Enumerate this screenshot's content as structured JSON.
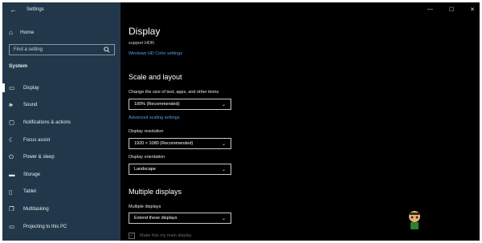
{
  "window": {
    "title": "Settings",
    "controls": [
      "—",
      "☐",
      "✕"
    ]
  },
  "sidebar": {
    "home_label": "Home",
    "search_placeholder": "Find a setting",
    "section_label": "System",
    "items": [
      {
        "label": "Display",
        "icon": "monitor-icon",
        "glyph": "▭",
        "active": true
      },
      {
        "label": "Sound",
        "icon": "sound-icon",
        "glyph": "🕪",
        "active": false
      },
      {
        "label": "Notifications & actions",
        "icon": "notifications-icon",
        "glyph": "▢",
        "active": false
      },
      {
        "label": "Focus assist",
        "icon": "focus-assist-icon",
        "glyph": "☾",
        "active": false
      },
      {
        "label": "Power & sleep",
        "icon": "power-icon",
        "glyph": "⏻",
        "active": false
      },
      {
        "label": "Storage",
        "icon": "storage-icon",
        "glyph": "▬",
        "active": false
      },
      {
        "label": "Tablet",
        "icon": "tablet-icon",
        "glyph": "▯",
        "active": false
      },
      {
        "label": "Multitasking",
        "icon": "multitasking-icon",
        "glyph": "❐",
        "active": false
      },
      {
        "label": "Projecting to this PC",
        "icon": "projecting-icon",
        "glyph": "▭",
        "active": false
      }
    ]
  },
  "main": {
    "title": "Display",
    "support_text": "support HDR.",
    "hdr_link": "Windows HD Color settings",
    "scale_heading": "Scale and layout",
    "scale_label": "Change the size of text, apps, and other items",
    "scale_value": "100% (Recommended)",
    "advanced_link": "Advanced scaling settings",
    "resolution_label": "Display resolution",
    "resolution_value": "1920 × 1080 (Recommended)",
    "orientation_label": "Display orientation",
    "orientation_value": "Landscape",
    "multiple_heading": "Multiple displays",
    "multiple_label": "Multiple displays",
    "multiple_value": "Extend these displays",
    "main_display_label": "Make this my main display",
    "main_display_checked": true
  },
  "colors": {
    "sidebar_bg": "#22384a",
    "accent_link": "#4aa3ee",
    "main_bg": "#000000"
  }
}
